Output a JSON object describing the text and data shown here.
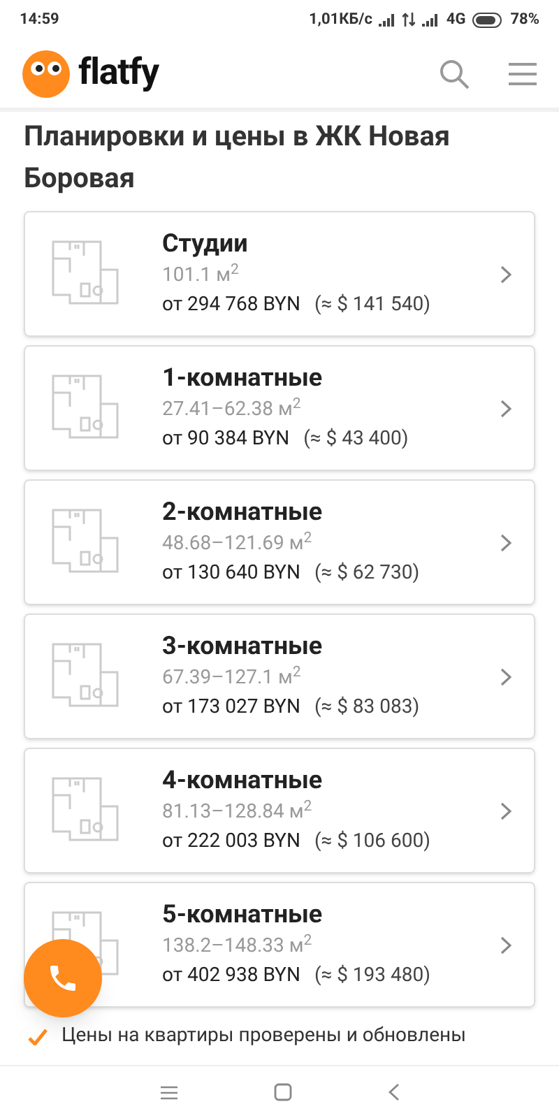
{
  "status_bar": {
    "time": "14:59",
    "speed": "1,01КБ/с",
    "network": "4G",
    "battery": "78%"
  },
  "header": {
    "logo": "flatfy"
  },
  "title": "Планировки и цены в ЖК Новая Боровая",
  "layouts": [
    {
      "name": "Студии",
      "area": "101.1 м$^{2}$",
      "price": "от 294 768 BYN",
      "usd": "(≈ $ 141 540)"
    },
    {
      "name": "1-комнатные",
      "area": "27.41–62.38 м$^{2}$",
      "price": "от 90 384 BYN",
      "usd": "(≈ $ 43 400)"
    },
    {
      "name": "2-комнатные",
      "area": "48.68–121.69 м$^{2}$",
      "price": "от 130 640 BYN",
      "usd": "(≈ $ 62 730)"
    },
    {
      "name": "3-комнатные",
      "area": "67.39–127.1 м$^{2}$",
      "price": "от 173 027 BYN",
      "usd": "(≈ $ 83 083)"
    },
    {
      "name": "4-комнатные",
      "area": "81.13–128.84 м$^{2}$",
      "price": "от 222 003 BYN",
      "usd": "(≈ $ 106 600)"
    },
    {
      "name": "5-комнатные",
      "area": "138.2–148.33 м$^{2}$",
      "price": "от 402 938 BYN",
      "usd": "(≈ $ 193 480)"
    }
  ],
  "note": "Цены на квартиры проверены и обновлены"
}
